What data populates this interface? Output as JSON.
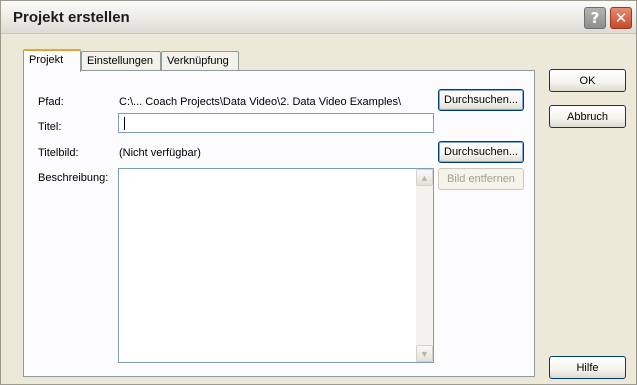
{
  "window": {
    "title": "Projekt erstellen",
    "help_icon_glyph": "?",
    "close_icon_glyph": "✕"
  },
  "tabs": [
    {
      "label": "Projekt",
      "active": true
    },
    {
      "label": "Einstellungen",
      "active": false
    },
    {
      "label": "Verknüpfung",
      "active": false
    }
  ],
  "form": {
    "pfad_label": "Pfad:",
    "pfad_value": "C:\\... Coach Projects\\Data Video\\2. Data Video Examples\\",
    "titel_label": "Titel:",
    "titel_value": "",
    "titelbild_label": "Titelbild:",
    "titelbild_value": "(Nicht verfügbar)",
    "beschreibung_label": "Beschreibung:",
    "beschreibung_value": ""
  },
  "buttons": {
    "browse_path": "Durchsuchen...",
    "browse_image": "Durchsuchen...",
    "remove_image": "Bild entfernen",
    "ok": "OK",
    "cancel": "Abbruch",
    "help": "Hilfe"
  },
  "icons": {
    "scroll_up": "▲",
    "scroll_down": "▼"
  },
  "colors": {
    "dialog_bg": "#ece9d8",
    "panel_bg": "#fcfcfe",
    "button_border": "#003c74",
    "close_red": "#c7492a",
    "active_tab_accent": "#e6a23c"
  }
}
